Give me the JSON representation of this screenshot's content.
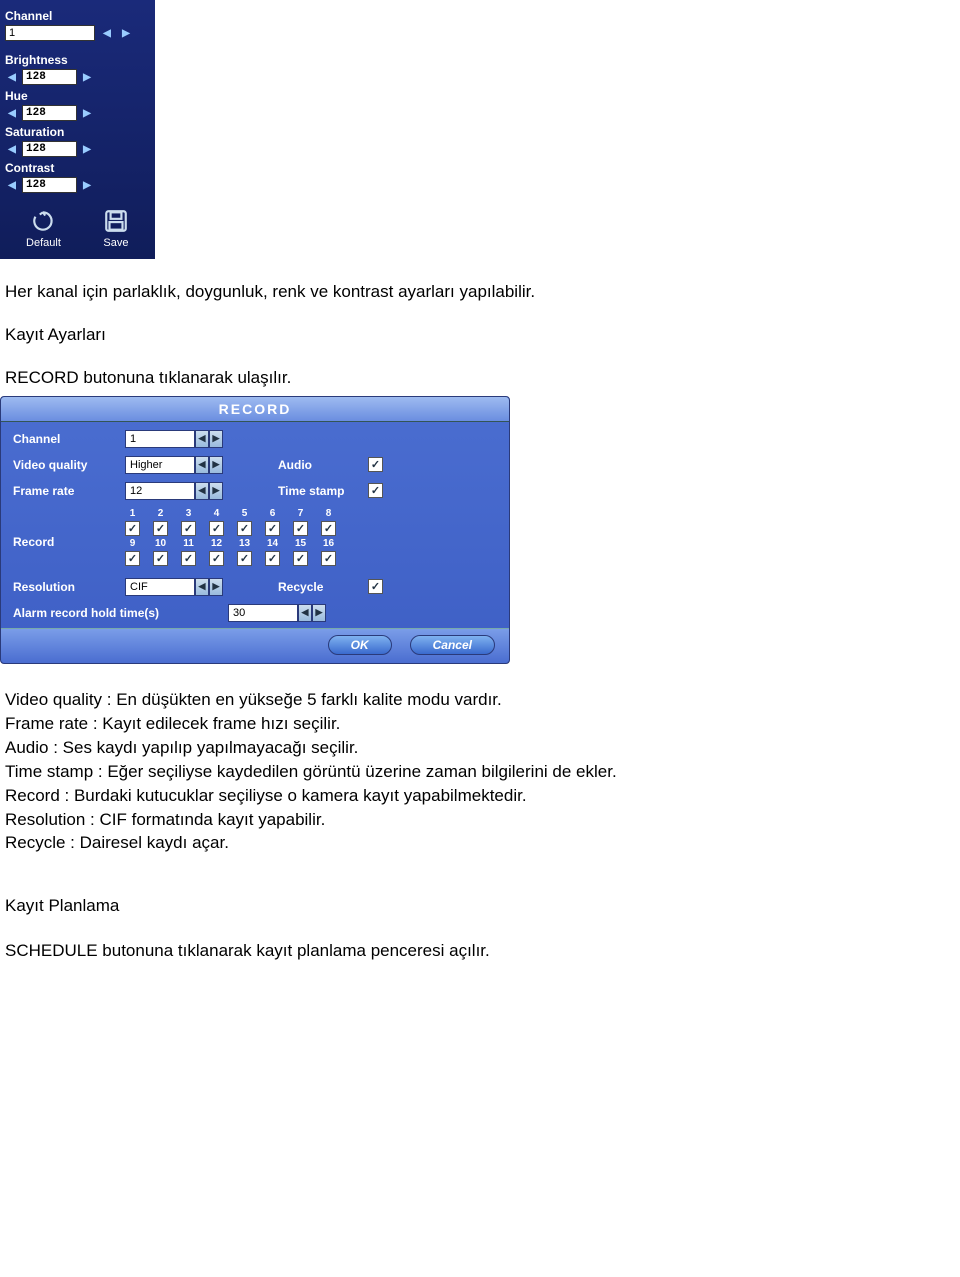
{
  "panel1": {
    "channel_label": "Channel",
    "channel_value": "1",
    "brightness_label": "Brightness",
    "brightness_value": "128",
    "hue_label": "Hue",
    "hue_value": "128",
    "saturation_label": "Saturation",
    "saturation_value": "128",
    "contrast_label": "Contrast",
    "contrast_value": "128",
    "default_label": "Default",
    "save_label": "Save"
  },
  "doc1": {
    "p1": "Her kanal için parlaklık, doygunluk, renk ve kontrast ayarları yapılabilir.",
    "p2": "Kayıt Ayarları",
    "p3": "RECORD butonuna tıklanarak ulaşılır."
  },
  "panel2": {
    "title": "RECORD",
    "channel_label": "Channel",
    "channel_value": "1",
    "video_quality_label": "Video quality",
    "video_quality_value": "Higher",
    "audio_label": "Audio",
    "audio_checked": true,
    "frame_rate_label": "Frame rate",
    "frame_rate_value": "12",
    "timestamp_label": "Time stamp",
    "timestamp_checked": true,
    "record_label": "Record",
    "record_nums1": [
      "1",
      "2",
      "3",
      "4",
      "5",
      "6",
      "7",
      "8"
    ],
    "record_nums2": [
      "9",
      "10",
      "11",
      "12",
      "13",
      "14",
      "15",
      "16"
    ],
    "record_checked": [
      true,
      true,
      true,
      true,
      true,
      true,
      true,
      true,
      true,
      true,
      true,
      true,
      true,
      true,
      true,
      true
    ],
    "resolution_label": "Resolution",
    "resolution_value": "CIF",
    "recycle_label": "Recycle",
    "recycle_checked": true,
    "alarm_label": "Alarm record hold time(s)",
    "alarm_value": "30",
    "ok_label": "OK",
    "cancel_label": "Cancel"
  },
  "doc2": {
    "p1": "Video quality : En düşükten en yükseğe 5 farklı kalite modu vardır.",
    "p2": "Frame rate : Kayıt edilecek frame hızı seçilir.",
    "p3": "Audio : Ses kaydı yapılıp yapılmayacağı seçilir.",
    "p4": "Time stamp : Eğer seçiliyse kaydedilen  görüntü üzerine zaman bilgilerini de ekler.",
    "p5": "Record : Burdaki kutucuklar seçiliyse o kamera kayıt yapabilmektedir.",
    "p6": "Resolution : CIF formatında kayıt yapabilir.",
    "p7": "Recycle : Dairesel kaydı açar.",
    "p8": "Kayıt Planlama",
    "p9": "SCHEDULE butonuna tıklanarak kayıt planlama penceresi açılır."
  }
}
